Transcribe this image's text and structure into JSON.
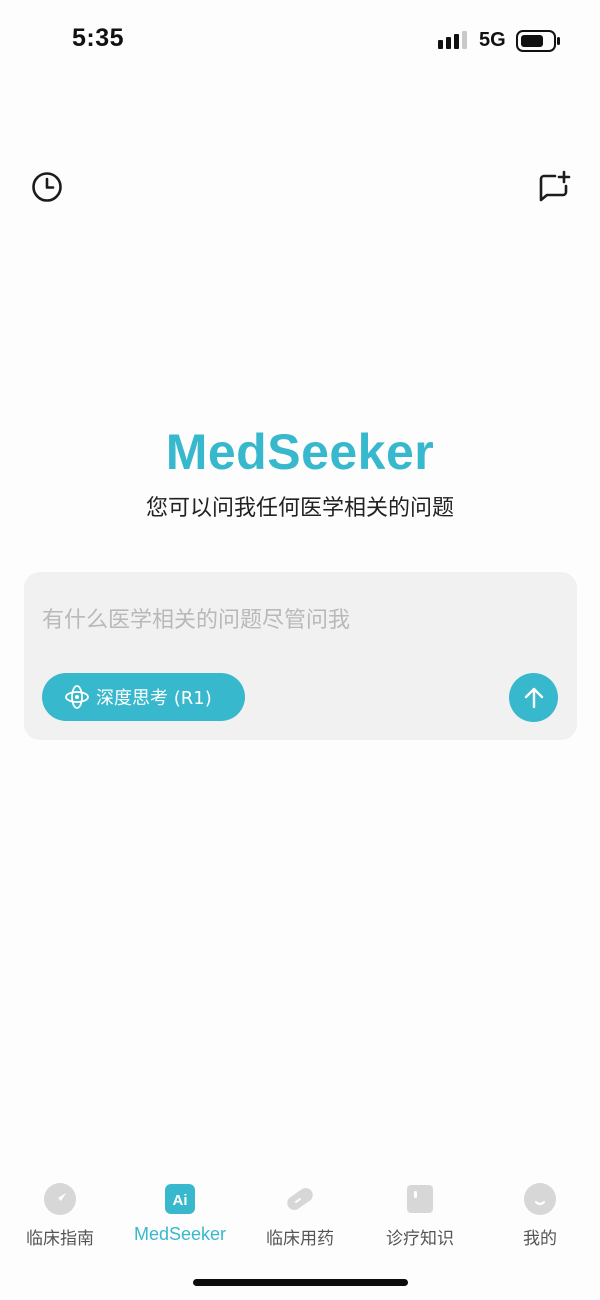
{
  "status_bar": {
    "time": "5:35",
    "network": "5G",
    "icons": [
      "signal-icon",
      "battery-icon"
    ]
  },
  "top_bar": {
    "left_icon": "history-clock-icon",
    "right_icon": "new-chat-icon"
  },
  "hero": {
    "brand": "MedSeeker",
    "subtitle": "您可以问我任何医学相关的问题"
  },
  "composer": {
    "placeholder": "有什么医学相关的问题尽管问我",
    "value": "",
    "deep_think_label": "深度思考 (R1)",
    "deep_think_icon": "atom-icon",
    "send_icon": "arrow-up-icon"
  },
  "tab_bar": {
    "items": [
      {
        "label": "临床指南",
        "icon": "compass-icon",
        "active": false
      },
      {
        "label": "MedSeeker",
        "icon": "ai-icon",
        "active": true
      },
      {
        "label": "临床用药",
        "icon": "pill-icon",
        "active": false
      },
      {
        "label": "诊疗知识",
        "icon": "book-icon",
        "active": false
      },
      {
        "label": "我的",
        "icon": "profile-icon",
        "active": false
      }
    ]
  },
  "colors": {
    "accent": "#37b8cc",
    "card_bg": "#f1f1f1",
    "inactive_icon": "#d7d7d7",
    "inactive_label": "#555555"
  }
}
